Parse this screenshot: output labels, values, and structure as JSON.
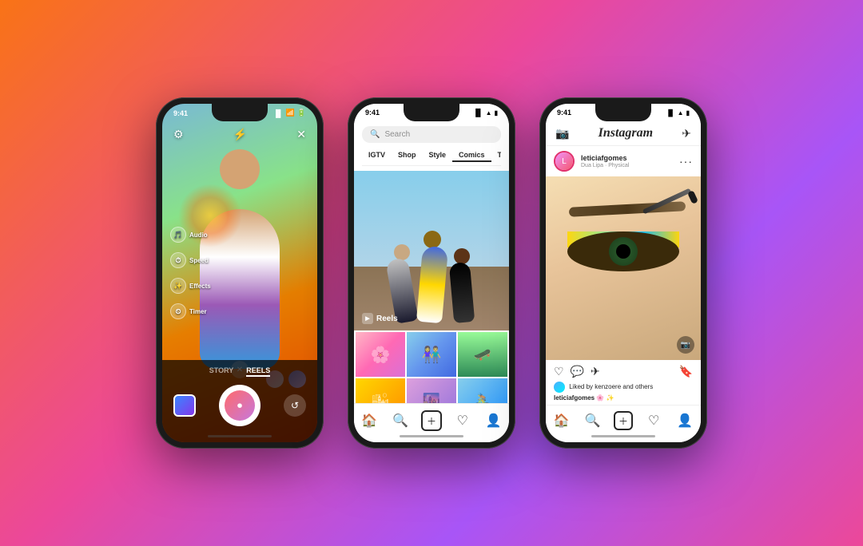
{
  "background": {
    "gradient": "linear-gradient(135deg, #f97316 0%, #ec4899 40%, #a855f7 70%, #ec4899 100%)"
  },
  "phone1": {
    "status_time": "9:41",
    "camera_controls": [
      {
        "label": "Audio",
        "icon": "🎵"
      },
      {
        "label": "Speed",
        "icon": "⏱"
      },
      {
        "label": "Effects",
        "icon": "✨"
      },
      {
        "label": "Timer",
        "icon": "⏲"
      }
    ],
    "tabs": [
      "STORY",
      "REELS"
    ],
    "active_tab": "REELS"
  },
  "phone2": {
    "status_time": "9:41",
    "search_placeholder": "Search",
    "tabs": [
      "IGTV",
      "Shop",
      "Style",
      "Comics",
      "TV & Movie"
    ],
    "active_tab": "Comics",
    "reels_label": "Reels",
    "nav_icons": [
      "home",
      "search",
      "add",
      "heart",
      "profile"
    ]
  },
  "phone3": {
    "status_time": "9:41",
    "app_name": "Instagram",
    "post": {
      "username": "leticiafgomes",
      "subtitle": "Dua Lipa · Physical",
      "likes_by": "kenzoere",
      "likes_text": "Liked by kenzoere and others",
      "caption": "leticiafgomes 🌸 ✨"
    },
    "nav_icons": [
      "home",
      "search",
      "add",
      "heart",
      "profile"
    ]
  }
}
